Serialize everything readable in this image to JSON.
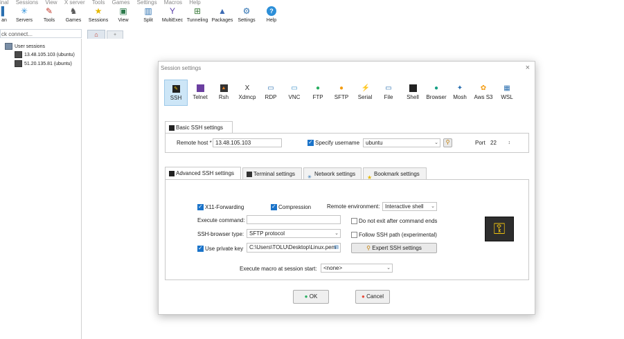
{
  "menu": [
    "inal",
    "Sessions",
    "View",
    "X server",
    "Tools",
    "Games",
    "Settings",
    "Macros",
    "Help"
  ],
  "toolbar": [
    {
      "label": "an",
      "icon": "session-icon"
    },
    {
      "label": "Servers",
      "icon": "servers-icon"
    },
    {
      "label": "Tools",
      "icon": "tools-icon"
    },
    {
      "label": "Games",
      "icon": "games-icon"
    },
    {
      "label": "Sessions",
      "icon": "star-icon"
    },
    {
      "label": "View",
      "icon": "view-icon"
    },
    {
      "label": "Split",
      "icon": "split-icon"
    },
    {
      "label": "MultiExec",
      "icon": "multiexec-icon"
    },
    {
      "label": "Tunneling",
      "icon": "tunneling-icon"
    },
    {
      "label": "Packages",
      "icon": "packages-icon"
    },
    {
      "label": "Settings",
      "icon": "settings-icon"
    },
    {
      "label": "Help",
      "icon": "help-icon"
    }
  ],
  "quick_connect": {
    "placeholder": "ck connect..."
  },
  "tabs": {
    "home_icon": "home-icon",
    "plus": "+"
  },
  "sidebar": {
    "root": "User sessions",
    "items": [
      "13.48.105.103 (ubuntu)",
      "51.20.135.81 (ubuntu)"
    ]
  },
  "dialog": {
    "title": "Session settings",
    "close": "×",
    "protocols": [
      {
        "label": "SSH",
        "icon": "ssh-icon"
      },
      {
        "label": "Telnet",
        "icon": "telnet-icon"
      },
      {
        "label": "Rsh",
        "icon": "rsh-icon"
      },
      {
        "label": "Xdmcp",
        "icon": "xdmcp-icon"
      },
      {
        "label": "RDP",
        "icon": "rdp-icon"
      },
      {
        "label": "VNC",
        "icon": "vnc-icon"
      },
      {
        "label": "FTP",
        "icon": "ftp-icon"
      },
      {
        "label": "SFTP",
        "icon": "sftp-icon"
      },
      {
        "label": "Serial",
        "icon": "serial-icon"
      },
      {
        "label": "File",
        "icon": "file-icon"
      },
      {
        "label": "Shell",
        "icon": "shell-icon"
      },
      {
        "label": "Browser",
        "icon": "browser-icon"
      },
      {
        "label": "Mosh",
        "icon": "mosh-icon"
      },
      {
        "label": "Aws S3",
        "icon": "aws-s3-icon"
      },
      {
        "label": "WSL",
        "icon": "wsl-icon"
      }
    ],
    "basic_tab": "Basic SSH settings",
    "remote_host_label": "Remote host *",
    "remote_host_value": "13.48.105.103",
    "specify_username_label": "Specify username",
    "username_value": "ubuntu",
    "port_label": "Port",
    "port_value": "22",
    "adv_tabs": [
      "Advanced SSH settings",
      "Terminal settings",
      "Network settings",
      "Bookmark settings"
    ],
    "x11_label": "X11-Forwarding",
    "compression_label": "Compression",
    "remote_env_label": "Remote environment:",
    "remote_env_value": "Interactive shell",
    "execute_command_label": "Execute command:",
    "execute_command_value": "",
    "do_not_exit_label": "Do not exit after command ends",
    "ssh_browser_label": "SSH-browser type:",
    "ssh_browser_value": "SFTP protocol",
    "follow_ssh_label": "Follow SSH path (experimental)",
    "private_key_label": "Use private key",
    "private_key_value": "C:\\Users\\TOLU\\Desktop\\Linux.pem",
    "expert_button": "Expert SSH settings",
    "macro_label": "Execute macro at session start:",
    "macro_value": "<none>",
    "ok_button": "OK",
    "cancel_button": "Cancel"
  }
}
